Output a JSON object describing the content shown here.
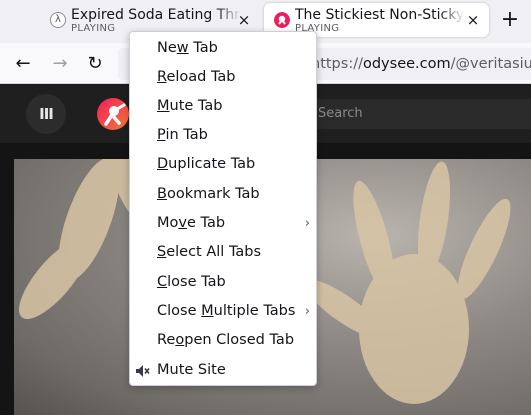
{
  "tabs": [
    {
      "title": "Expired Soda Eating Throu",
      "status": "PLAYING",
      "favicon": "odysee-placeholder-icon",
      "close": "×"
    },
    {
      "title": "The Stickiest Non-Sticky S",
      "status": "PLAYING",
      "favicon": "odysee-logo-icon",
      "close": "×",
      "active": true
    }
  ],
  "new_tab_label": "+",
  "nav": {
    "back": "←",
    "forward": "→",
    "reload": "↻",
    "url_prefix": "https://",
    "url_domain": "odysee.com",
    "url_path": "/@veritasium:"
  },
  "site": {
    "menu_icon": "III",
    "search_placeholder": "Search",
    "accent": "#e50054"
  },
  "context_menu": {
    "items": [
      {
        "before": "Ne",
        "ul": "w",
        "after": " Tab"
      },
      {
        "before": "",
        "ul": "R",
        "after": "eload Tab"
      },
      {
        "before": "",
        "ul": "M",
        "after": "ute Tab"
      },
      {
        "before": "",
        "ul": "P",
        "after": "in Tab"
      },
      {
        "before": "",
        "ul": "D",
        "after": "uplicate Tab"
      },
      {
        "before": "",
        "ul": "B",
        "after": "ookmark Tab"
      },
      {
        "before": "Mo",
        "ul": "v",
        "after": "e Tab",
        "submenu": "›"
      },
      {
        "before": "",
        "ul": "S",
        "after": "elect All Tabs"
      },
      {
        "before": "",
        "ul": "C",
        "after": "lose Tab"
      },
      {
        "before": "Close ",
        "ul": "M",
        "after": "ultiple Tabs",
        "submenu": "›"
      },
      {
        "before": "Re",
        "ul": "o",
        "after": "pen Closed Tab"
      },
      {
        "before": "",
        "ul": "",
        "after": "Mute Site",
        "icon": "mute-speaker-icon"
      }
    ]
  }
}
